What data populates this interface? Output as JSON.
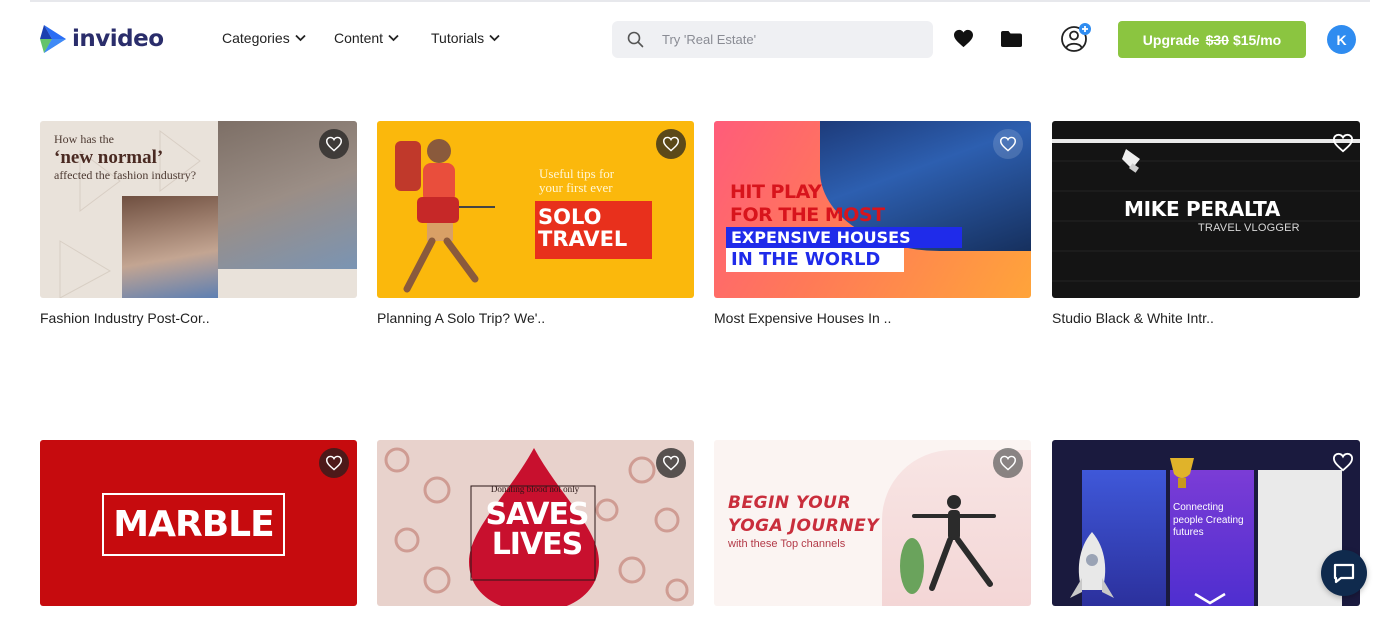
{
  "brand": {
    "name": "invideo"
  },
  "nav": {
    "categories": "Categories",
    "content": "Content",
    "tutorials": "Tutorials"
  },
  "search": {
    "placeholder": "Try 'Real Estate'",
    "value": ""
  },
  "upgrade": {
    "label": "Upgrade",
    "old_price": "$30",
    "new_price": "$15/mo"
  },
  "user": {
    "initial": "K"
  },
  "colors": {
    "accent_green": "#8bc540",
    "avatar_blue": "#2f8cf0",
    "chat_navy": "#0f2a4d"
  },
  "icons": {
    "search": "search-icon",
    "favorites": "heart-icon",
    "folder": "folder-icon",
    "team": "add-user-icon",
    "chat": "chat-icon"
  },
  "templates": [
    {
      "title": "Fashion Industry Post-Cor..",
      "thumb": {
        "line1": "How has the",
        "line2": "‘new normal’",
        "line3": "affected the fashion industry?"
      }
    },
    {
      "title": "Planning A Solo Trip? We'..",
      "thumb": {
        "tips": "Useful tips for your first ever",
        "headline": "SOLO TRAVEL"
      }
    },
    {
      "title": "Most Expensive Houses In ..",
      "thumb": {
        "line1": "HIT PLAY",
        "line2": "FOR THE MOST",
        "line3": "EXPENSIVE HOUSES",
        "line4": "IN THE WORLD"
      }
    },
    {
      "title": "Studio Black & White Intr..",
      "thumb": {
        "name": "MIKE PERALTA",
        "role": "TRAVEL VLOGGER"
      }
    },
    {
      "title": "",
      "thumb": {
        "headline": "MARBLE"
      }
    },
    {
      "title": "",
      "thumb": {
        "small": "Donating blood not only",
        "line1": "SAVES",
        "line2": "LIVES"
      }
    },
    {
      "title": "",
      "thumb": {
        "line1": "BEGIN YOUR",
        "line2": "YOGA JOURNEY",
        "sub": "with these Top channels"
      }
    },
    {
      "title": "",
      "thumb": {
        "text": "Connecting people Creating futures"
      }
    }
  ]
}
